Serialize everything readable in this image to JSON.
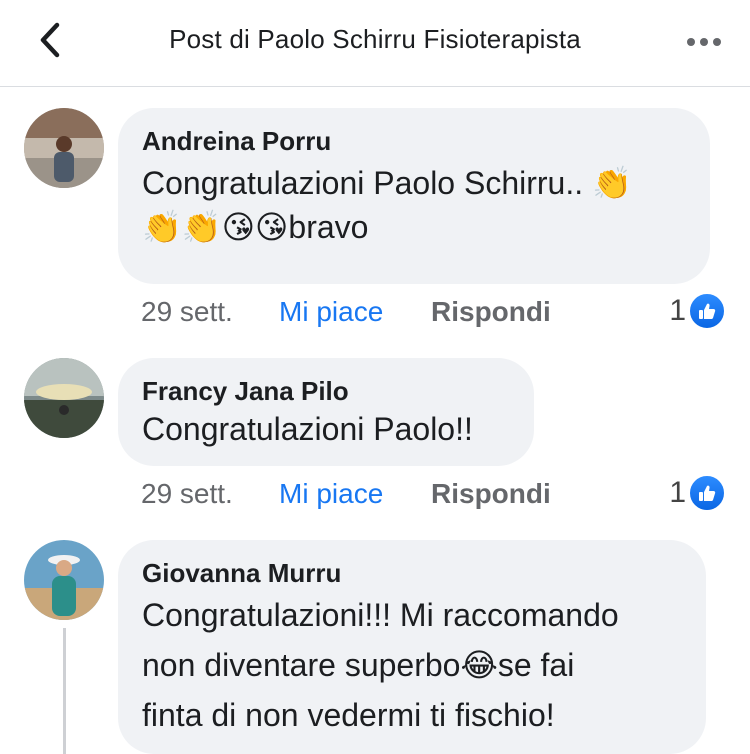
{
  "header": {
    "title": "Post di Paolo Schirru Fisioterapista",
    "back_icon": "chevron-left-icon",
    "more_icon": "more-dots-icon"
  },
  "comments": [
    {
      "author": "Andreina Porru",
      "text_line1": "Congratulazioni Paolo Schirru.. 👏",
      "text_line2": "👏👏😘😘bravo",
      "time": "29 sett.",
      "like_label": "Mi piace",
      "reply_label": "Rispondi",
      "reaction_count": "1",
      "reaction_icon": "like-icon"
    },
    {
      "author": "Francy Jana Pilo",
      "text_line1": "Congratulazioni Paolo!!",
      "time": "29 sett.",
      "like_label": "Mi piace",
      "reply_label": "Rispondi",
      "reaction_count": "1",
      "reaction_icon": "like-icon"
    },
    {
      "author": "Giovanna Murru",
      "text_line1": "Congratulazioni!!! Mi raccomando",
      "text_line2": "non diventare superbo😂se fai",
      "text_line3": "finta di non vedermi ti fischio!"
    }
  ],
  "colors": {
    "accent": "#1877f2",
    "bubble": "#f0f2f5",
    "secondary_text": "#65676b"
  }
}
